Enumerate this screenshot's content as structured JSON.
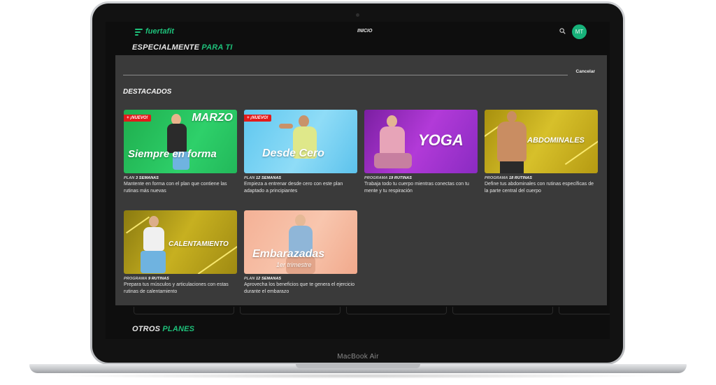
{
  "device": {
    "label": "MacBook Air"
  },
  "app": {
    "logo_text": "fuertafit",
    "nav_home": "INICIO",
    "avatar_initials": "MT",
    "accent_color": "#1ec07a"
  },
  "sections": {
    "special_prefix": "ESPECIALMENTE",
    "special_accent": "PARA TI",
    "other_prefix": "OTROS",
    "other_accent": "PLANES"
  },
  "search": {
    "value": "",
    "cancel_label": "Cancelar"
  },
  "featured": {
    "heading": "DESTACADOS",
    "cards": [
      {
        "title_top": "MARZO",
        "title": "Siempre en forma",
        "badge": "+ ¡NUEVO!",
        "type": "PLAN",
        "count": "3 SEMANAS",
        "description": "Mantente en forma con el plan que contiene las rutinas más nuevas"
      },
      {
        "title": "Desde Cero",
        "badge": "+ ¡NUEVO!",
        "type": "PLAN",
        "count": "12 SEMANAS",
        "description": "Empieza a entrenar desde cero con este plan adaptado a principiantes"
      },
      {
        "title": "YOGA",
        "type": "PROGRAMA",
        "count": "19 RUTINAS",
        "description": "Trabaja todo tu cuerpo mientras conectas con tu mente y tu respiración"
      },
      {
        "title": "ABDOMINALES",
        "type": "PROGRAMA",
        "count": "18 RUTINAS",
        "description": "Define tus abdominales con rutinas específicas de la parte central del cuerpo"
      },
      {
        "title": "CALENTAMIENTO",
        "type": "PROGRAMA",
        "count": "9 RUTINAS",
        "description": "Prepara tus músculos y articulaciones con estas rutinas de calentamiento"
      },
      {
        "title": "Embarazadas",
        "subtitle": "1er trimestre",
        "type": "PLAN",
        "count": "12 SEMANAS",
        "description": "Aprovecha los beneficios que te genera el ejercicio durante el embarazo"
      }
    ]
  }
}
